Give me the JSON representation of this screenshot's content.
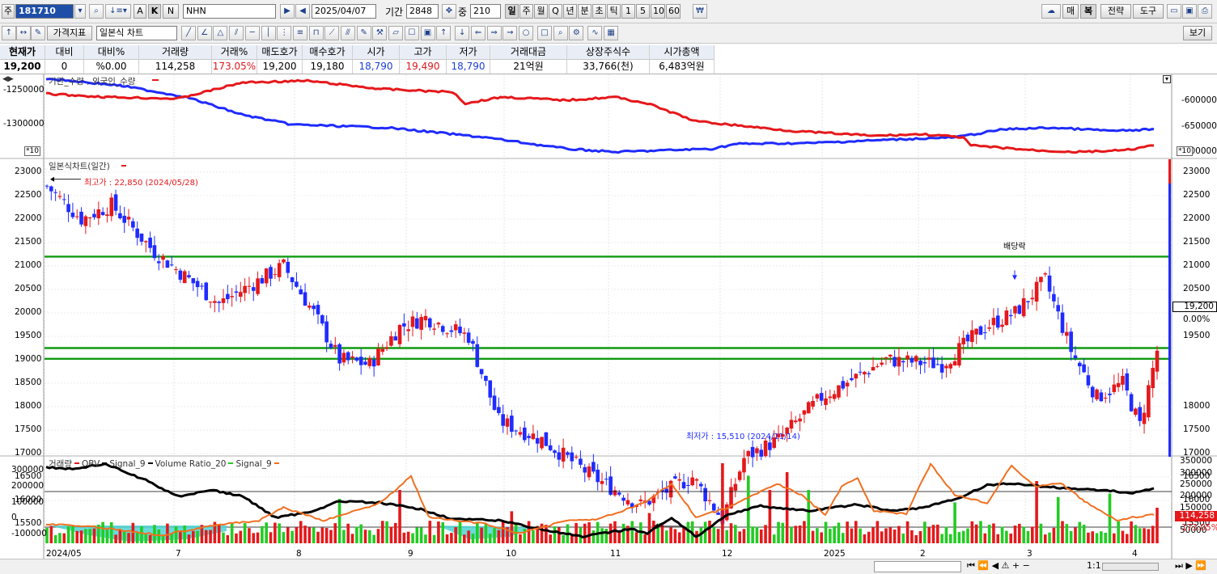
{
  "toolbar1": {
    "market_label": "주",
    "code": "181710",
    "name": "NHN",
    "date": "2025/04/07",
    "period_label": "기간",
    "period_value": "2848",
    "count_label": "중",
    "count_value": "210",
    "timeframes": [
      "일",
      "주",
      "월",
      "Q",
      "년",
      "분",
      "초",
      "틱",
      "1",
      "5",
      "10",
      "60"
    ],
    "mode_buttons": [
      "A",
      "K",
      "N"
    ],
    "right_buttons": [
      "매",
      "복",
      "전략",
      "도구"
    ]
  },
  "toolbar2": {
    "indicator_label": "가격지표",
    "chart_type_value": "일본식 차트",
    "view_label": "보기"
  },
  "quote": {
    "headers": [
      "현재가",
      "대비",
      "대비%",
      "거래량",
      "거래%",
      "매도호가",
      "매수호가",
      "시가",
      "고가",
      "저가",
      "거래대금",
      "상장주식수",
      "시가총액"
    ],
    "values": [
      "19,200",
      "0",
      "%0.00",
      "114,258",
      "173.05%",
      "19,200",
      "19,180",
      "18,790",
      "19,490",
      "18,790",
      "21억원",
      "33,766(천)",
      "6,483억원"
    ]
  },
  "top_pane": {
    "legend": "기관_수량 , 외국인_수량",
    "left_ticks": [
      "-1250000",
      "-1300000"
    ],
    "right_ticks": [
      "-600000",
      "-650000",
      "-700000"
    ],
    "scale_badge": "*10",
    "colors": {
      "institution": "#1f2bff",
      "foreign": "#e5181b"
    }
  },
  "main_pane": {
    "legend": "일본식차트(일간)",
    "left_ticks": [
      "23000",
      "22500",
      "22000",
      "21500",
      "21000",
      "20500",
      "20000",
      "19500",
      "19000",
      "18500",
      "18000",
      "17500",
      "17000",
      "16500",
      "16000",
      "15500"
    ],
    "right_ticks": [
      "23000",
      "22500",
      "22000",
      "21500",
      "21000",
      "20500",
      "19500",
      "18000",
      "17500",
      "17000",
      "16500",
      "16000",
      "15500"
    ],
    "high_annotation": "최고가 : 22,850 (2024/05/28)",
    "low_annotation": "최저가 : 15,510 (2024/11/14)",
    "dividend_label": "배당락",
    "current_price_tag": "19,200",
    "pct_tag": "0.00%",
    "horizontal_lines": [
      21200,
      19250,
      19020
    ],
    "colors": {
      "up": "#e5181b",
      "down": "#1f2bff",
      "hline": "#119a11"
    }
  },
  "volume_pane": {
    "legend_parts": [
      "거래량",
      "OBV",
      "Signal_9",
      "Volume Ratio_20",
      "Signal_9"
    ],
    "left_ticks": [
      "300000",
      "200000",
      "100000",
      "0",
      "-100000"
    ],
    "right_ticks": [
      "350000",
      "300000",
      "250000",
      "200000",
      "150000",
      "100000",
      "50000"
    ],
    "volume_tag": "114,258",
    "ratio_tag": "173.05%"
  },
  "x_axis": {
    "labels": [
      "2024/05",
      "7",
      "8",
      "9",
      "10",
      "11",
      "12",
      "2025",
      "2",
      "3",
      "4"
    ]
  },
  "bottom_bar": {
    "zoom_label": "1:1"
  }
}
